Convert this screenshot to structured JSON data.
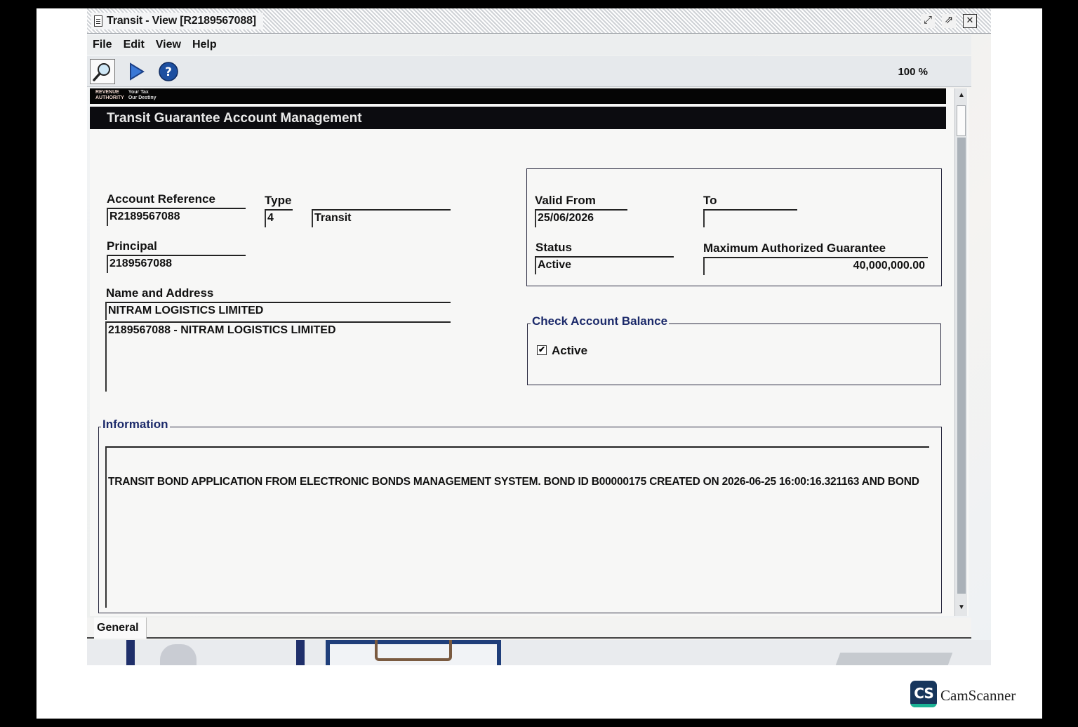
{
  "window": {
    "title": "Transit - View [R2189567088]",
    "controls": {
      "restore": "⤢",
      "maximize": "⇗",
      "close": "✕"
    }
  },
  "menu": [
    "File",
    "Edit",
    "View",
    "Help"
  ],
  "toolbar": {
    "icons": [
      "magnifier-icon",
      "play-arrow-icon",
      "help-icon"
    ],
    "zoom": "100 %"
  },
  "banner": {
    "logo_left": "REVENUE\nAUTHORITY",
    "logo_right": "Your Tax\nOur Destiny"
  },
  "header": {
    "title": "Transit Guarantee Account Management"
  },
  "form": {
    "account_reference": {
      "label": "Account Reference",
      "value": "R2189567088"
    },
    "type": {
      "label": "Type",
      "code": "4",
      "name": "Transit"
    },
    "principal": {
      "label": "Principal",
      "value": "2189567088"
    },
    "name_address": {
      "label": "Name and Address",
      "line1": "NITRAM LOGISTICS LIMITED",
      "line2": "2189567088 - NITRAM LOGISTICS LIMITED"
    },
    "valid_from": {
      "label": "Valid From",
      "value": "25/06/2026"
    },
    "to": {
      "label": "To",
      "value": ""
    },
    "status": {
      "label": "Status",
      "value": "Active"
    },
    "max_guarantee": {
      "label": "Maximum Authorized Guarantee",
      "value": "40,000,000.00"
    }
  },
  "balance": {
    "legend": "Check Account Balance",
    "checkbox_label": "Active",
    "checked": true,
    "check_glyph": "✔"
  },
  "information": {
    "legend": "Information",
    "text": "TRANSIT BOND APPLICATION FROM ELECTRONIC BONDS MANAGEMENT SYSTEM. BOND ID B00000175 CREATED ON 2026-06-25 16:00:16.321163 AND BOND"
  },
  "tabs": [
    "General"
  ],
  "scrollbar": {
    "up": "▲",
    "down": "▼"
  },
  "watermark": {
    "badge": "CS",
    "name": "CamScanner"
  },
  "colors": {
    "header_bg": "#0c0c10",
    "legend_text": "#1c2a6a",
    "scroll_track": "#aab1b8"
  }
}
